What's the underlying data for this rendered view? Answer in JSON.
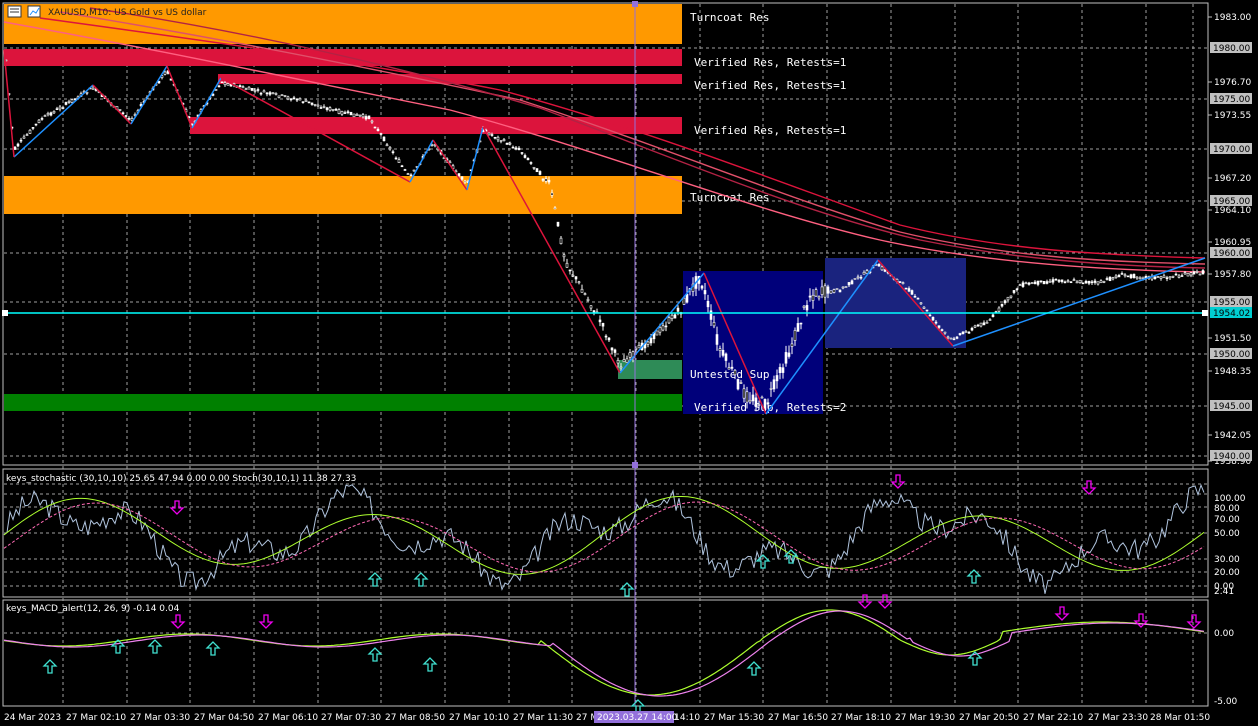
{
  "window": {
    "symbol_title": "XAUUSD,M10: US Gold vs US dollar",
    "icons": [
      "chart-menu-icon",
      "chart-properties-icon"
    ]
  },
  "price_axis": {
    "labels": [
      "1983.00",
      "1976.70",
      "1973.55",
      "1967.20",
      "1964.10",
      "1960.95",
      "1957.80",
      "1951.50",
      "1948.35",
      "1942.05",
      "1938.90"
    ],
    "boxed": [
      {
        "label": "1980.00",
        "bg": "#c0c0c0"
      },
      {
        "label": "1975.00",
        "bg": "#c0c0c0"
      },
      {
        "label": "1970.00",
        "bg": "#c0c0c0"
      },
      {
        "label": "1965.00",
        "bg": "#c0c0c0"
      },
      {
        "label": "1960.00",
        "bg": "#c0c0c0"
      },
      {
        "label": "1955.00",
        "bg": "#c0c0c0"
      },
      {
        "label": "1954.02",
        "bg": "#00ced1"
      },
      {
        "label": "1950.00",
        "bg": "#c0c0c0"
      },
      {
        "label": "1945.00",
        "bg": "#c0c0c0"
      },
      {
        "label": "1940.00",
        "bg": "#c0c0c0"
      }
    ]
  },
  "zones": [
    {
      "label": "Turncoat Res",
      "color": "#ff9900"
    },
    {
      "label": "Verified Res, Retests=1",
      "color": "#dc143c"
    },
    {
      "label": "Verified Res, Retests=1",
      "color": "#dc143c"
    },
    {
      "label": "Verified Res, Retests=1",
      "color": "#dc143c"
    },
    {
      "label": "Turncoat Res",
      "color": "#ff9900"
    },
    {
      "label": "Untested Sup",
      "color": "#2e8b57"
    },
    {
      "label": "Verified Sup, Retests=2",
      "color": "#008000"
    }
  ],
  "stochastic": {
    "title": "keys_stochastic (30,10,10) 25.65 47.94 0.00 0.00 Stoch(30,10,1) 11.38 27.33",
    "levels": [
      "100.00",
      "80.00",
      "70.00",
      "50.00",
      "30.00",
      "20.00",
      "0.00"
    ]
  },
  "macd": {
    "title": "keys_MACD_alert(12, 26, 9) -0.14 0.04",
    "levels": [
      "2.41",
      "0.00",
      "-5.00"
    ]
  },
  "time_axis": {
    "labels": [
      "24 Mar 2023",
      "27 Mar 02:10",
      "27 Mar 03:30",
      "27 Mar 04:50",
      "27 Mar 06:10",
      "27 Mar 07:30",
      "27 Mar 08:50",
      "27 Mar 10:10",
      "27 Mar 11:30",
      "27 Mar 12:50",
      "27 Mar 14:10",
      "27 Mar 15:30",
      "27 Mar 16:50",
      "27 Mar 18:10",
      "27 Mar 19:30",
      "27 Mar 20:50",
      "27 Mar 22:10",
      "27 Mar 23:30",
      "28 Mar 01:50"
    ],
    "cursor_label": "2023.03.27 14:00"
  },
  "colors": {
    "background": "#000000",
    "bull_candle": "#ffffff",
    "current_price_line": "#00ffff",
    "zigzag_down": "#dc143c",
    "zigzag_up": "#1e90ff",
    "crosshair": "#9370db"
  }
}
